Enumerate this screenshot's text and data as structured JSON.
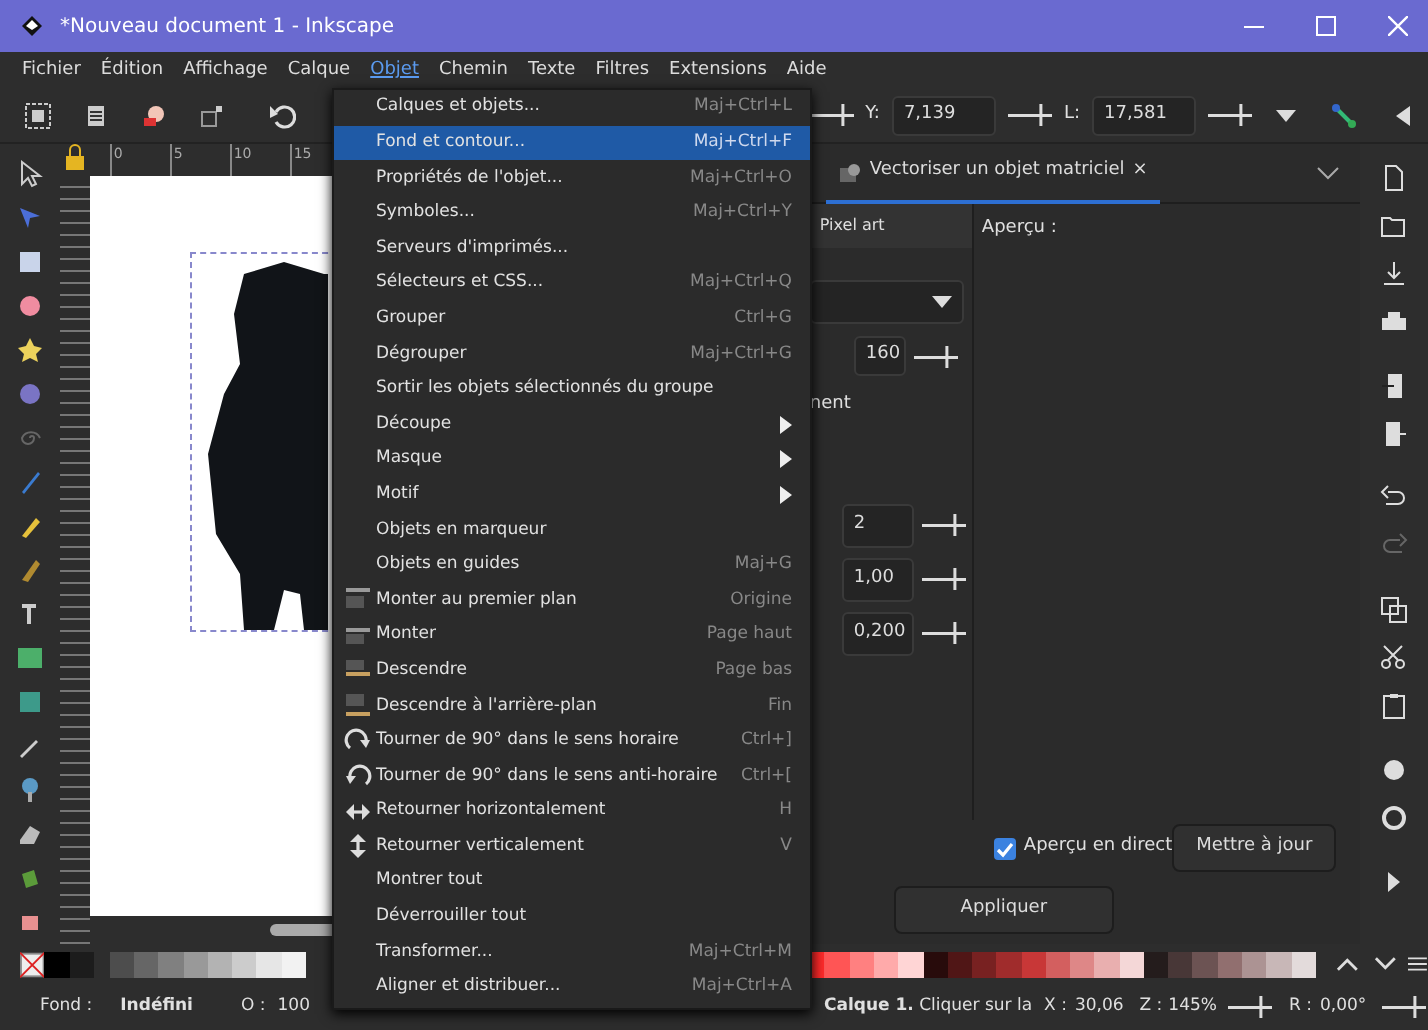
{
  "window": {
    "title": "*Nouveau document 1 - Inkscape"
  },
  "menubar": [
    {
      "label": "Fichier",
      "selected": false
    },
    {
      "label": "Édition",
      "selected": false
    },
    {
      "label": "Affichage",
      "selected": false
    },
    {
      "label": "Calque",
      "selected": false
    },
    {
      "label": "Objet",
      "selected": true
    },
    {
      "label": "Chemin",
      "selected": false
    },
    {
      "label": "Texte",
      "selected": false
    },
    {
      "label": "Filtres",
      "selected": false
    },
    {
      "label": "Extensions",
      "selected": false
    },
    {
      "label": "Aide",
      "selected": false
    }
  ],
  "toolbar": {
    "y_label": "Y:",
    "y_value": "7,139",
    "l_label": "L:",
    "l_value": "17,581"
  },
  "ruler": {
    "labels": [
      "0",
      "5",
      "10",
      "15"
    ]
  },
  "menu": [
    {
      "label": "Calques et objets...",
      "shortcut": "Maj+Ctrl+L",
      "kind": "plain",
      "selected": false
    },
    {
      "label": "Fond et contour...",
      "shortcut": "Maj+Ctrl+F",
      "kind": "plain",
      "selected": true
    },
    {
      "label": "Propriétés de l'objet...",
      "shortcut": "Maj+Ctrl+O",
      "kind": "plain",
      "selected": false
    },
    {
      "label": "Symboles...",
      "shortcut": "Maj+Ctrl+Y",
      "kind": "plain",
      "selected": false
    },
    {
      "label": "Serveurs d'imprimés...",
      "kind": "plain",
      "selected": false
    },
    {
      "label": "Sélecteurs et CSS...",
      "shortcut": "Maj+Ctrl+Q",
      "kind": "plain",
      "selected": false
    },
    {
      "label": "Grouper",
      "shortcut": "Ctrl+G",
      "kind": "plain",
      "selected": false
    },
    {
      "label": "Dégrouper",
      "shortcut": "Maj+Ctrl+G",
      "kind": "plain",
      "selected": false
    },
    {
      "label": "Sortir les objets sélectionnés du groupe",
      "kind": "plain",
      "selected": false
    },
    {
      "label": "Découpe",
      "kind": "submenu",
      "selected": false
    },
    {
      "label": "Masque",
      "kind": "submenu",
      "selected": false
    },
    {
      "label": "Motif",
      "kind": "submenu",
      "selected": false
    },
    {
      "label": "Objets en marqueur",
      "kind": "plain",
      "selected": false
    },
    {
      "label": "Objets en guides",
      "shortcut": "Maj+G",
      "kind": "plain",
      "selected": false
    },
    {
      "label": "Monter au premier plan",
      "shortcut": "Origine",
      "kind": "raise-top",
      "selected": false
    },
    {
      "label": "Monter",
      "shortcut": "Page haut",
      "kind": "raise",
      "selected": false
    },
    {
      "label": "Descendre",
      "shortcut": "Page bas",
      "kind": "lower",
      "selected": false
    },
    {
      "label": "Descendre à l'arrière-plan",
      "shortcut": "Fin",
      "kind": "lower-bottom",
      "selected": false
    },
    {
      "label": "Tourner de 90° dans le sens horaire",
      "shortcut": "Ctrl+]",
      "kind": "rotate-cw",
      "selected": false
    },
    {
      "label": "Tourner de 90° dans le sens anti-horaire",
      "shortcut": "Ctrl+[",
      "kind": "rotate-ccw",
      "selected": false
    },
    {
      "label": "Retourner horizontalement",
      "shortcut": "H",
      "kind": "flip-h",
      "selected": false
    },
    {
      "label": "Retourner verticalement",
      "shortcut": "V",
      "kind": "flip-v",
      "selected": false
    },
    {
      "label": "Montrer tout",
      "kind": "plain",
      "selected": false
    },
    {
      "label": "Déverrouiller tout",
      "kind": "plain",
      "selected": false
    },
    {
      "label": "Transformer...",
      "shortcut": "Maj+Ctrl+M",
      "kind": "plain",
      "selected": false
    },
    {
      "label": "Aligner et distribuer...",
      "shortcut": "Maj+Ctrl+A",
      "kind": "plain",
      "selected": false
    }
  ],
  "dock": {
    "tab": {
      "label": "Vectoriser un objet matriciel",
      "close": "×"
    },
    "subtab": "Pixel art",
    "threshold": "160",
    "cut_text": "nent",
    "spins": [
      "2",
      "1,00",
      "0,200"
    ],
    "preview_label": "Aperçu :",
    "live_preview": {
      "label": "Aperçu en direct",
      "checked": true
    },
    "update_button": "Mettre à jour",
    "apply_button": "Appliquer"
  },
  "palette": {
    "left": [
      {
        "color": "#000000"
      },
      {
        "color": "#1c1c1c"
      },
      {
        "color": "#4d4d4d"
      },
      {
        "color": "#666666"
      },
      {
        "color": "#808080"
      },
      {
        "color": "#999999"
      },
      {
        "color": "#b3b3b3"
      },
      {
        "color": "#cccccc"
      },
      {
        "color": "#e6e6e6"
      },
      {
        "color": "#f2f2f2"
      }
    ],
    "right": [
      {
        "color": "#ff2a2a"
      },
      {
        "color": "#ff5555"
      },
      {
        "color": "#ff8080"
      },
      {
        "color": "#ffaaaa"
      },
      {
        "color": "#ffd5d5"
      },
      {
        "color": "#280b0b"
      },
      {
        "color": "#501616"
      },
      {
        "color": "#782121"
      },
      {
        "color": "#a02c2c"
      },
      {
        "color": "#c83737"
      },
      {
        "color": "#d35f5f"
      },
      {
        "color": "#de8787"
      },
      {
        "color": "#e9afaf"
      },
      {
        "color": "#f4d7d7"
      },
      {
        "color": "#241c1c"
      },
      {
        "color": "#483737"
      },
      {
        "color": "#6c5353"
      },
      {
        "color": "#916f6f"
      },
      {
        "color": "#ac9393"
      },
      {
        "color": "#c8b7b7"
      },
      {
        "color": "#e3dbdb"
      }
    ]
  },
  "status": {
    "fill_label": "Fond :",
    "fill_value": "Indéfini",
    "opacity_label": "O :",
    "opacity_value": "100",
    "message": "**Calque 1.** Cliquer sur la",
    "x_label": "X :",
    "x_value": "30,06",
    "zoom_label": "Z :",
    "zoom_value": "145%",
    "rotate_label": "R :",
    "rotate_value": "0,00°"
  }
}
